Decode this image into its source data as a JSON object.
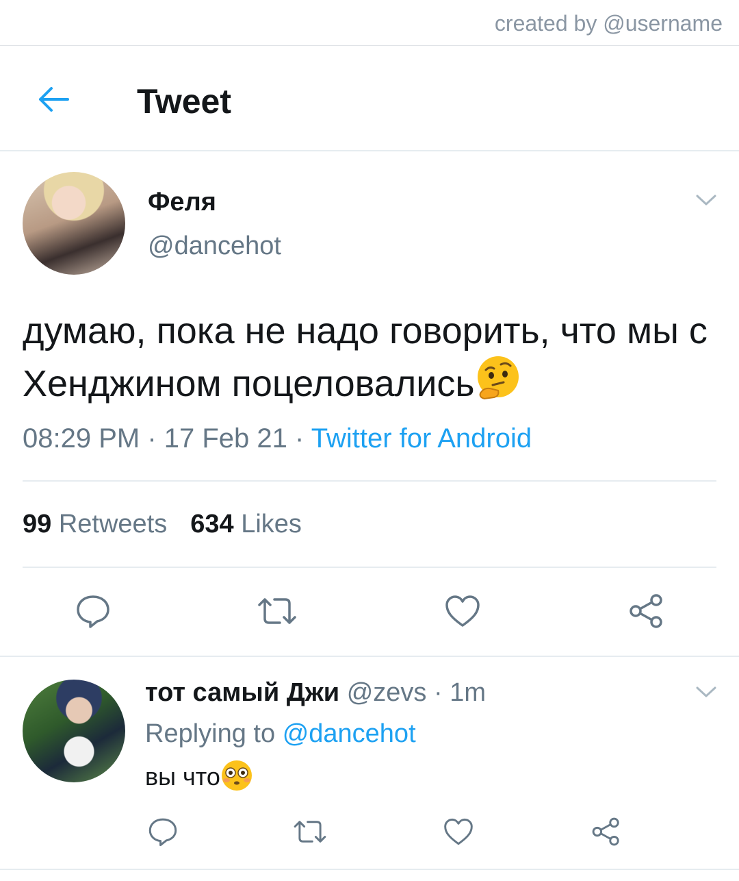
{
  "watermark": "created by @username",
  "header": {
    "title": "Tweet",
    "back_icon": "arrow-left-icon"
  },
  "tweet": {
    "author_name": "Феля",
    "author_handle": "@dancehot",
    "text": "думаю, пока не надо говорить, что мы с Хенджином поцеловались",
    "text_emoji": "thinking-face-emoji",
    "time": "08:29 PM",
    "separator": " · ",
    "date": "17 Feb 21",
    "source": "Twitter for Android",
    "retweets_count": "99",
    "retweets_label": "Retweets",
    "likes_count": "634",
    "likes_label": "Likes"
  },
  "reply": {
    "author_name": "тот самый Джи",
    "author_handle": "@zevs",
    "time_ago": "1m",
    "replying_label": "Replying to",
    "replying_to": "@dancehot",
    "text": "вы что",
    "text_emoji": "flushed-face-emoji"
  },
  "actions": [
    "reply-icon",
    "retweet-icon",
    "like-icon",
    "share-icon"
  ],
  "colors": {
    "accent": "#1da1f2",
    "secondary_text": "#657786",
    "primary_text": "#14171a",
    "divider": "#e6ecf0",
    "icon": "#657786"
  }
}
